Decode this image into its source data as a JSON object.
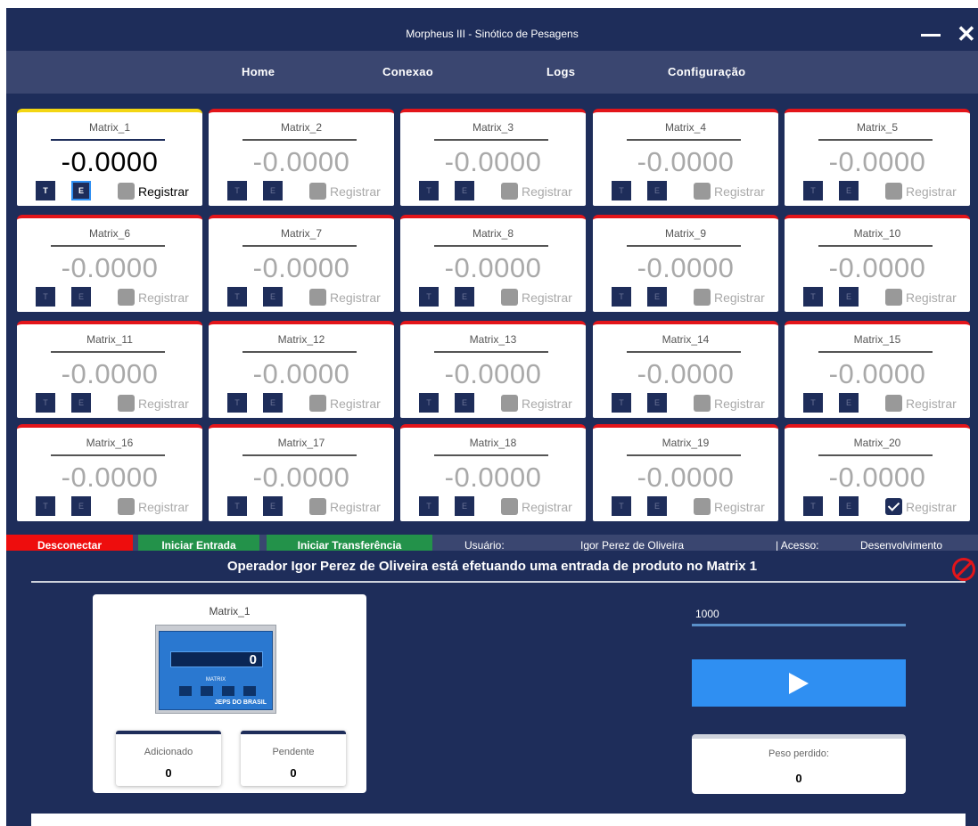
{
  "window": {
    "title": "Morpheus III - Sinótico de Pesagens"
  },
  "nav": {
    "home": "Home",
    "conexao": "Conexao",
    "logs": "Logs",
    "config": "Configuração"
  },
  "cards": [
    {
      "name": "Matrix_1",
      "value": "-0.0000",
      "t": "T",
      "e": "E",
      "reg": "Registrar"
    },
    {
      "name": "Matrix_2",
      "value": "-0.0000",
      "t": "T",
      "e": "E",
      "reg": "Registrar"
    },
    {
      "name": "Matrix_3",
      "value": "-0.0000",
      "t": "T",
      "e": "E",
      "reg": "Registrar"
    },
    {
      "name": "Matrix_4",
      "value": "-0.0000",
      "t": "T",
      "e": "E",
      "reg": "Registrar"
    },
    {
      "name": "Matrix_5",
      "value": "-0.0000",
      "t": "T",
      "e": "E",
      "reg": "Registrar"
    },
    {
      "name": "Matrix_6",
      "value": "-0.0000",
      "t": "T",
      "e": "E",
      "reg": "Registrar"
    },
    {
      "name": "Matrix_7",
      "value": "-0.0000",
      "t": "T",
      "e": "E",
      "reg": "Registrar"
    },
    {
      "name": "Matrix_8",
      "value": "-0.0000",
      "t": "T",
      "e": "E",
      "reg": "Registrar"
    },
    {
      "name": "Matrix_9",
      "value": "-0.0000",
      "t": "T",
      "e": "E",
      "reg": "Registrar"
    },
    {
      "name": "Matrix_10",
      "value": "-0.0000",
      "t": "T",
      "e": "E",
      "reg": "Registrar"
    },
    {
      "name": "Matrix_11",
      "value": "-0.0000",
      "t": "T",
      "e": "E",
      "reg": "Registrar"
    },
    {
      "name": "Matrix_12",
      "value": "-0.0000",
      "t": "T",
      "e": "E",
      "reg": "Registrar"
    },
    {
      "name": "Matrix_13",
      "value": "-0.0000",
      "t": "T",
      "e": "E",
      "reg": "Registrar"
    },
    {
      "name": "Matrix_14",
      "value": "-0.0000",
      "t": "T",
      "e": "E",
      "reg": "Registrar"
    },
    {
      "name": "Matrix_15",
      "value": "-0.0000",
      "t": "T",
      "e": "E",
      "reg": "Registrar"
    },
    {
      "name": "Matrix_16",
      "value": "-0.0000",
      "t": "T",
      "e": "E",
      "reg": "Registrar"
    },
    {
      "name": "Matrix_17",
      "value": "-0.0000",
      "t": "T",
      "e": "E",
      "reg": "Registrar"
    },
    {
      "name": "Matrix_18",
      "value": "-0.0000",
      "t": "T",
      "e": "E",
      "reg": "Registrar"
    },
    {
      "name": "Matrix_19",
      "value": "-0.0000",
      "t": "T",
      "e": "E",
      "reg": "Registrar"
    },
    {
      "name": "Matrix_20",
      "value": "-0.0000",
      "t": "T",
      "e": "E",
      "reg": "Registrar"
    }
  ],
  "actions": {
    "disconnect": "Desconectar",
    "entrada": "Iniciar Entrada",
    "transferencia": "Iniciar Transferência",
    "user_label": "Usuário:",
    "user_name": "Igor Perez de Oliveira",
    "access_label": "| Acesso:",
    "access_value": "Desenvolvimento"
  },
  "status": "Operador Igor Perez de Oliveira está efetuando uma entrada de produto no Matrix  1",
  "panel": {
    "name": "Matrix_1",
    "device_display": "0",
    "device_brand": "MATRIX",
    "device_logo": "JEPS DO BRASIL",
    "added_label": "Adicionado",
    "added_value": "0",
    "pending_label": "Pendente",
    "pending_value": "0"
  },
  "input": {
    "value": "1000"
  },
  "lost": {
    "label": "Peso perdido:",
    "value": "0"
  },
  "icons": {
    "minimize": "minimize-icon",
    "close": "close-icon",
    "play": "play-icon",
    "blocked": "blocked-icon",
    "check": "check-icon"
  },
  "colors": {
    "background": "#1e2d5a",
    "nav": "#3a4670",
    "disconnected": "#e3151a",
    "active": "#f3d613",
    "success": "#23924a",
    "accent": "#2f8ff2"
  }
}
